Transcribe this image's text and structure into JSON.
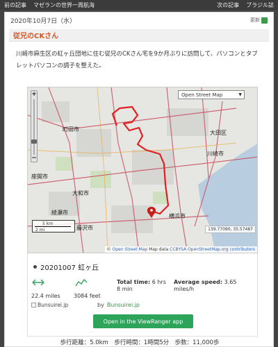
{
  "nav": {
    "prev_label": "前の記事",
    "site_label": "マゼランの世界一周航海",
    "next_label": "次の記事",
    "brazil_label": "ブラジル誌"
  },
  "post": {
    "date": "2020年10月7日（水）",
    "update_label": "更新",
    "title": "従兄のCKさん",
    "body": "川崎市麻生区の虹ヶ丘団地に住む従兄のCKさん宅を9か月ぶりに訪問して、パソコンとタブレットパソコンの調子を整えた。"
  },
  "map": {
    "layer_selected": "Open Street Map",
    "place_labels": {
      "machida": "町田市",
      "zama": "座間市",
      "yamato": "大和市",
      "ayase": "綾瀬市",
      "fujisawa": "藤沢市",
      "ota": "大田区",
      "kawasaki": "川崎市",
      "yokohama": "横浜市"
    },
    "scale_km": "5 km",
    "scale_mi": "2 mi",
    "coordinates": "139.77090, 35.57487",
    "attrib_prefix": "© ",
    "attrib_osm": "Open Street Map",
    "attrib_mid": "Map data ",
    "attrib_license": "CCBYSA",
    "attrib_contrib": "OpenStreetMap.org contributors",
    "route_color": "#e02020",
    "road_color": "#c9485b"
  },
  "route": {
    "name": "20201007 虹ヶ丘",
    "distance": "22.4 miles",
    "elevation": "3084 feet",
    "total_time_label": "Total time:",
    "total_time_value": "6 hrs 8 min",
    "avg_speed_label": "Average speed:",
    "avg_speed_value": "3.65 miles/h",
    "author_image_alt": "Bunsuirei.jp",
    "by_label": "by",
    "author_link": "Bunsuirei.jp",
    "app_button": "Open in the ViewRanger app",
    "accent_color": "#2ea35a"
  },
  "footer": {
    "stats": "歩行距離：5.0km　歩行時間：1時間5分　歩数：11,000歩"
  }
}
